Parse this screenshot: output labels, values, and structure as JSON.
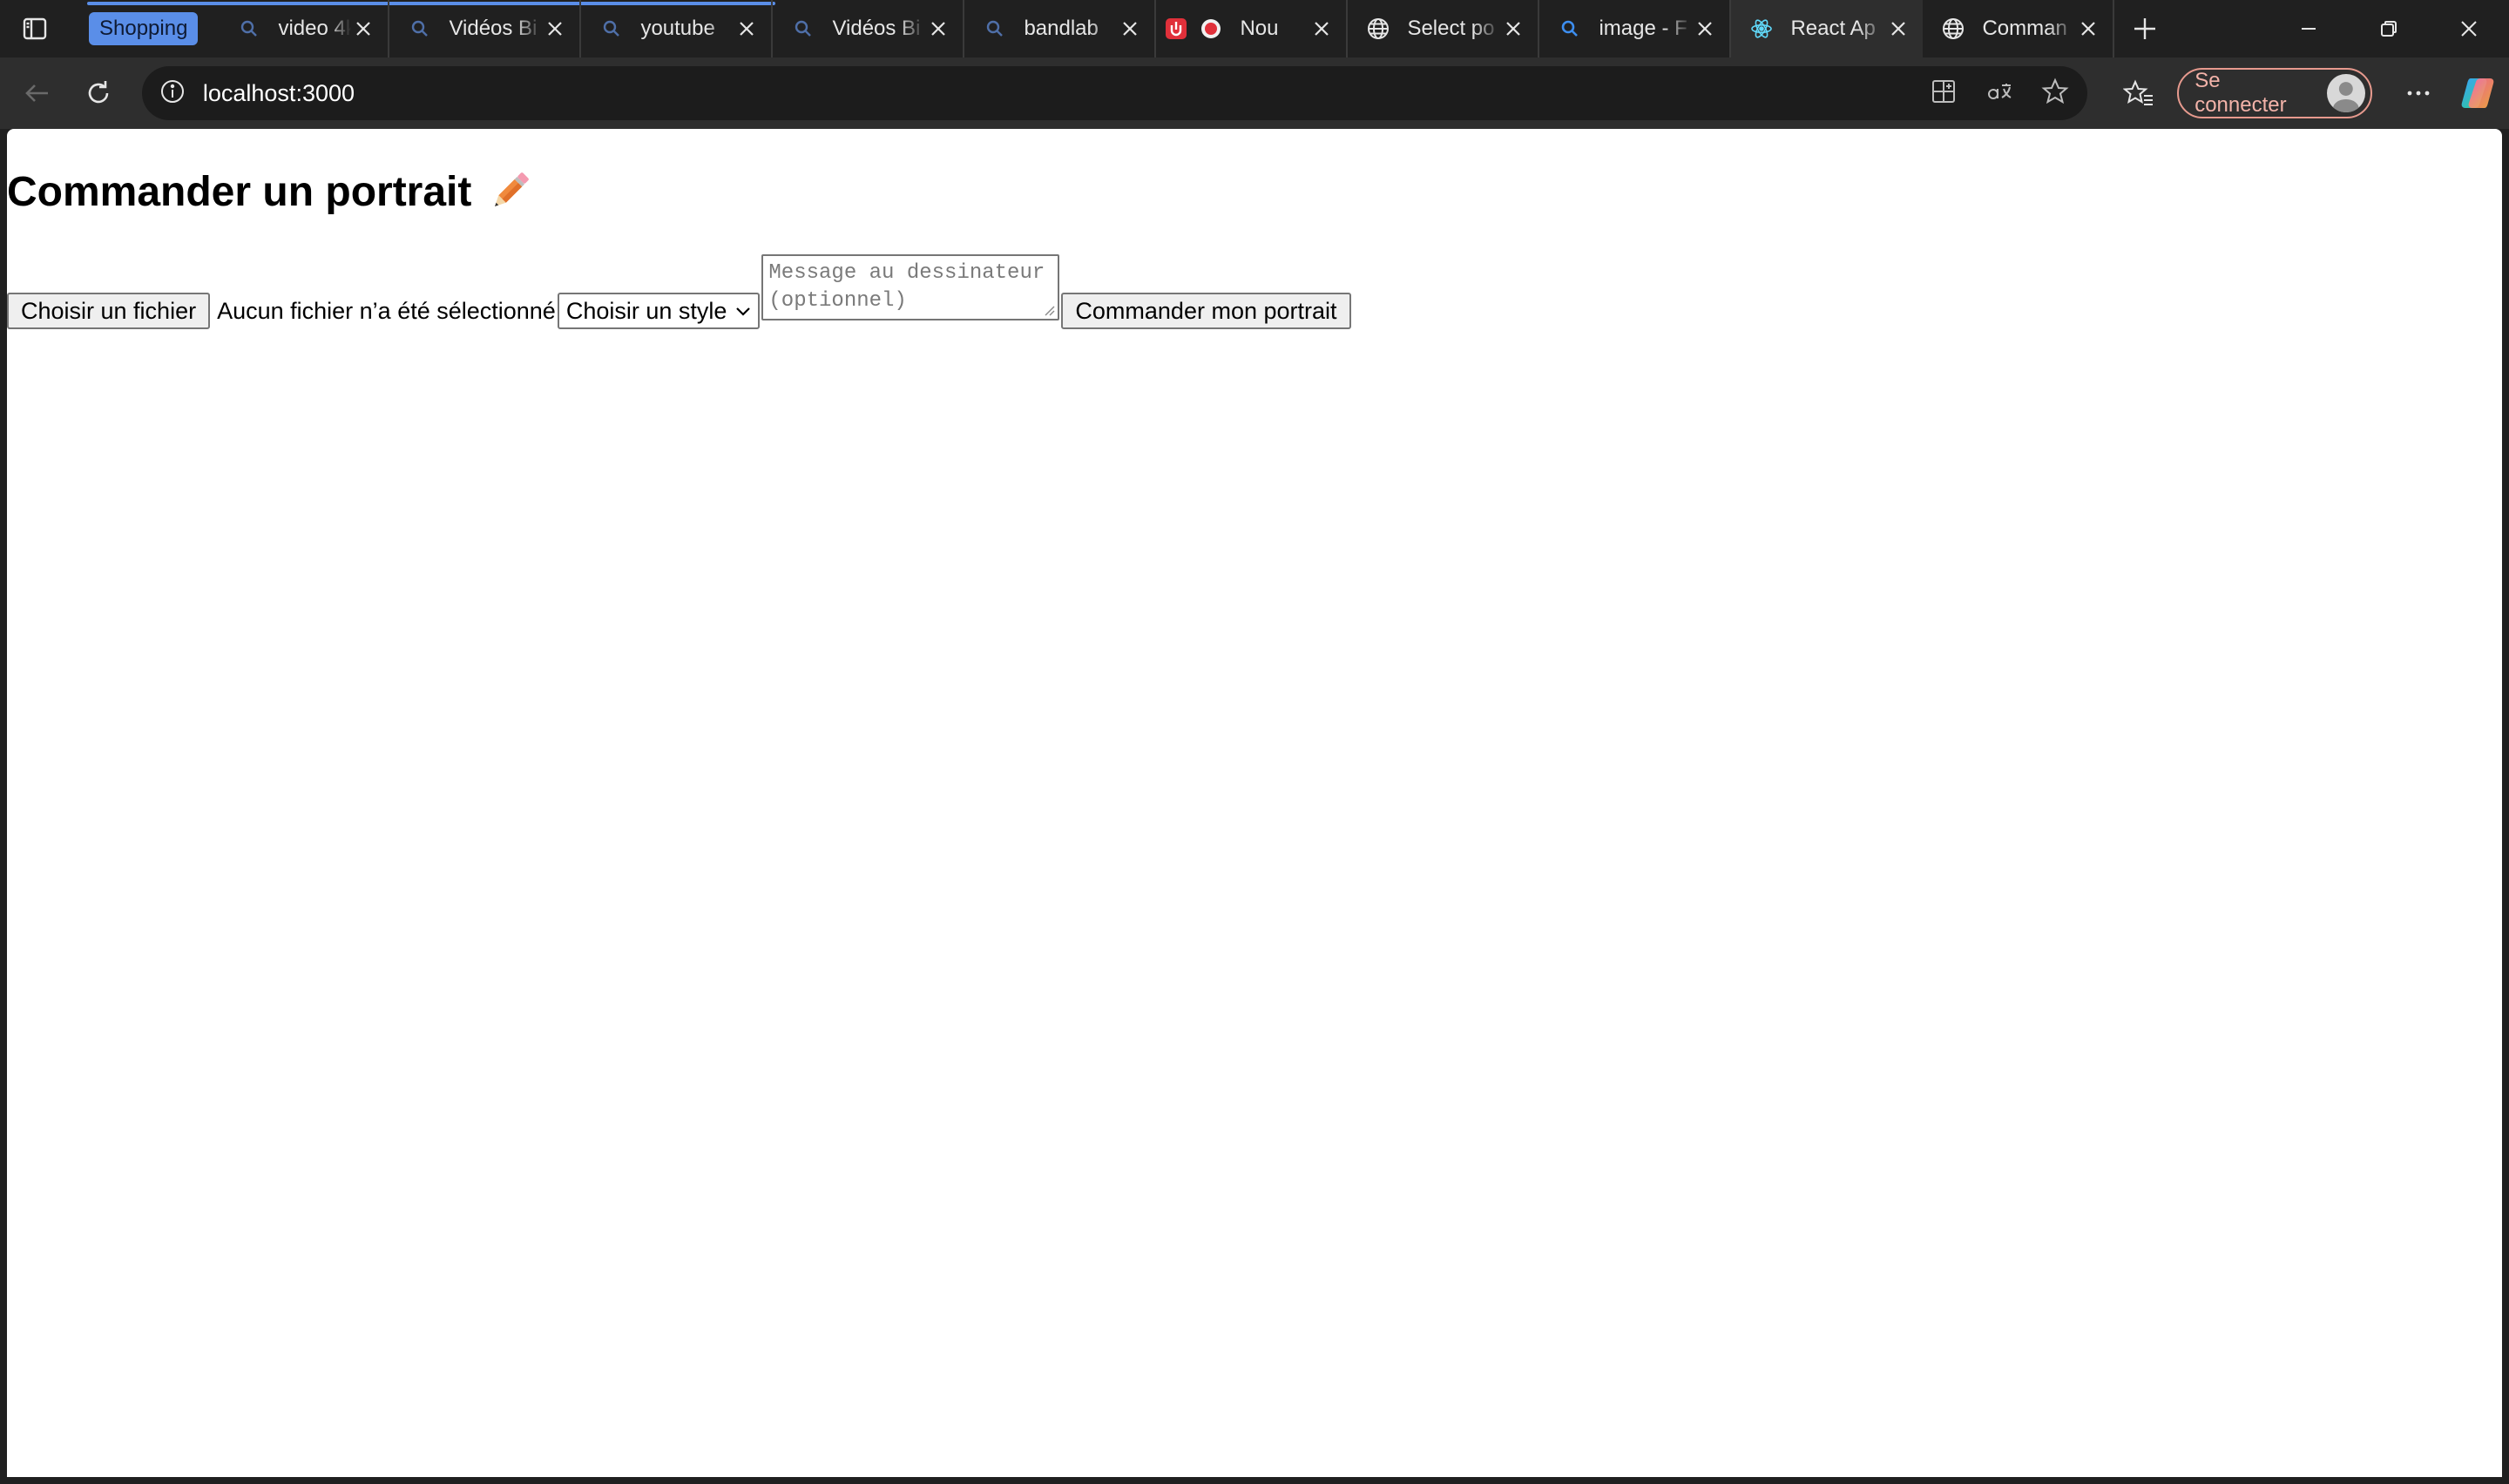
{
  "tab_group": {
    "label": "Shopping",
    "color": "#5a8ee8"
  },
  "tabs": [
    {
      "title": "video 4k",
      "icon": "search-icon"
    },
    {
      "title": "Vidéos Bi",
      "icon": "search-icon"
    },
    {
      "title": "youtube",
      "icon": "search-icon"
    },
    {
      "title": "Vidéos Bi",
      "icon": "search-icon"
    },
    {
      "title": "bandlab",
      "icon": "search-icon"
    },
    {
      "title": "Nou",
      "icon": "record-icon"
    },
    {
      "title": "Select po",
      "icon": "globe-icon"
    },
    {
      "title": "image - F",
      "icon": "search-icon"
    },
    {
      "title": "React Ap",
      "icon": "react-icon",
      "active": true
    },
    {
      "title": "Comman",
      "icon": "globe-icon"
    }
  ],
  "toolbar": {
    "url": "localhost:3000",
    "signin_label": "Se connecter"
  },
  "page": {
    "title": "Commander un portrait",
    "title_icon": "pencil-icon",
    "file_button": "Choisir un fichier",
    "file_status": "Aucun fichier n’a été sélectionné",
    "style_select": "Choisir un style",
    "message_placeholder": "Message au dessinateur (optionnel)",
    "submit_button": "Commander mon portrait"
  }
}
